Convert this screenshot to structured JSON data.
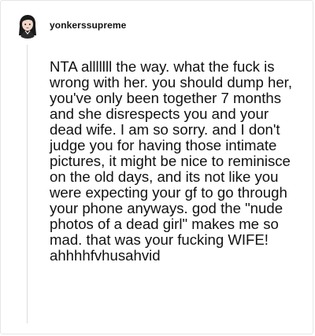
{
  "post": {
    "author": {
      "username": "yonkerssupreme",
      "avatar_icon": "avatar-girl-icon"
    },
    "body": "NTA alllllll the way. what the fuck is wrong with her. you should dump her, you've only been together 7 months and she disrespects you and your dead wife. I am so sorry. and I don't judge you for having those intimate pictures, it might be nice to reminisce on the old days, and its not like you were expecting your gf to go through your phone anyways. god the \"nude photos of a dead girl\" makes me so mad. that was your fucking WIFE! ahhhhfvhusahvid"
  },
  "colors": {
    "text": "#111111",
    "border": "#e6e6e6",
    "thread_line": "#dcdcdc",
    "background": "#ffffff"
  }
}
